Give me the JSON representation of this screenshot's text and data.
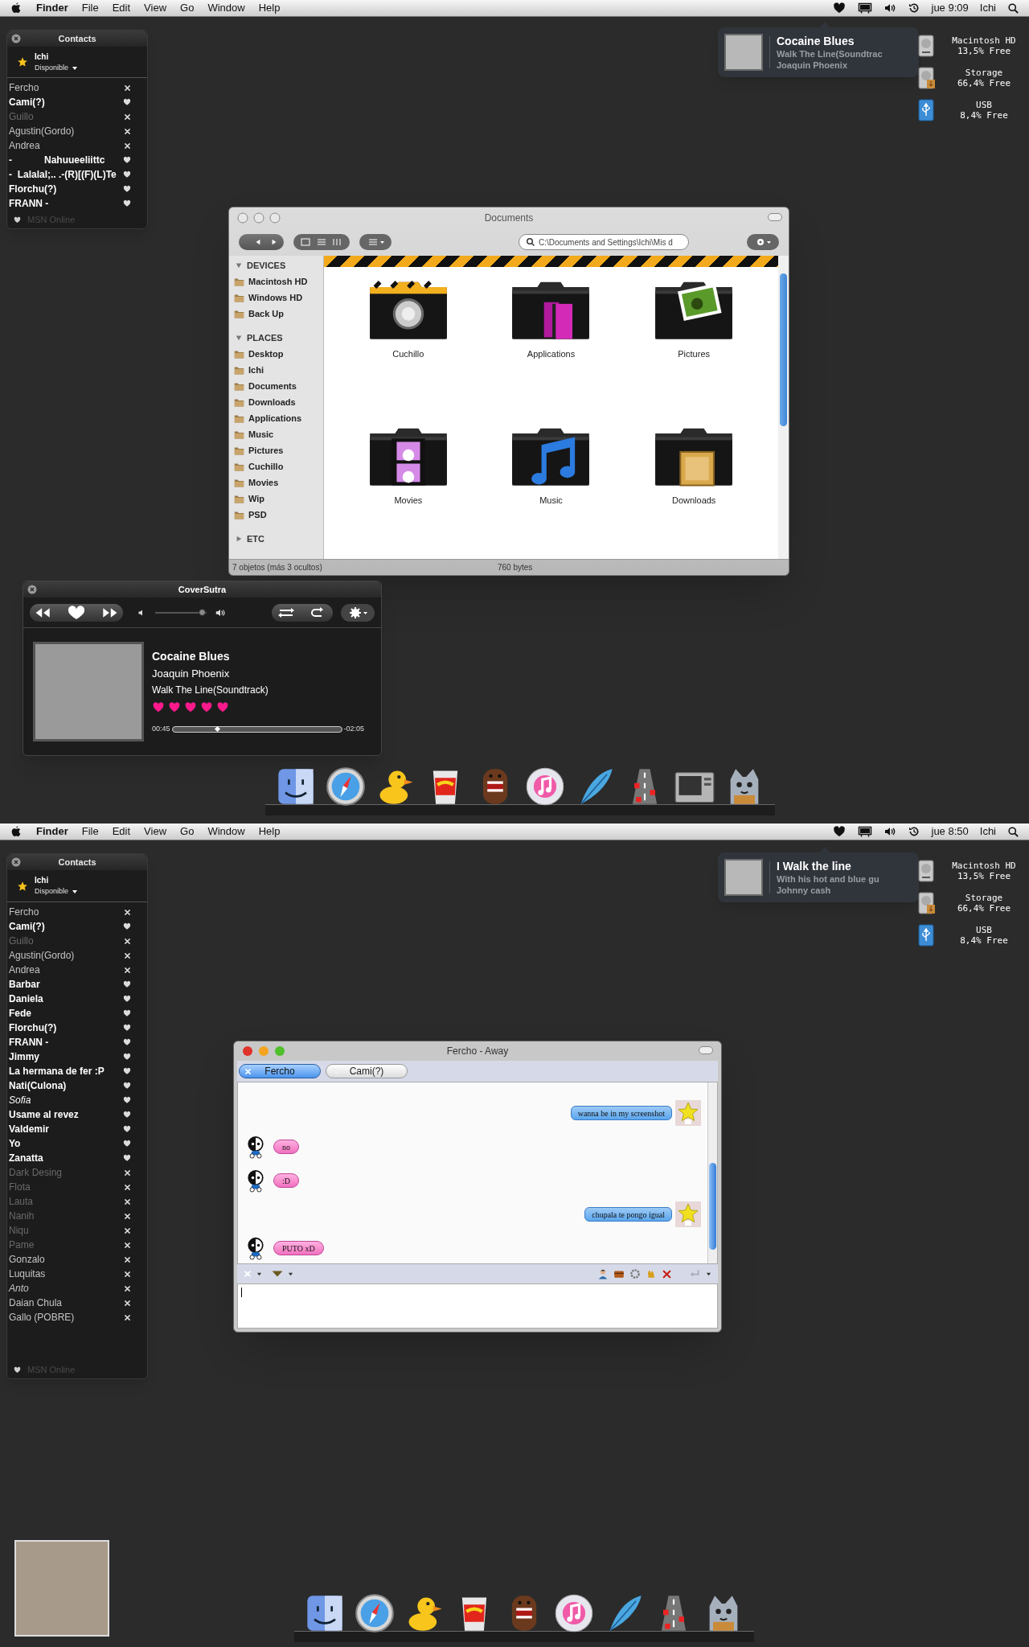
{
  "top_screen": {
    "menu_bar": {
      "app": "Finder",
      "menus": [
        "File",
        "Edit",
        "View",
        "Go",
        "Window",
        "Help"
      ],
      "clock": "jue 9:09",
      "user": "Ichi"
    },
    "contacts": {
      "title": "Contacts",
      "user": "Ichi",
      "status": "Disponible",
      "footer": "MSN Online",
      "contacts": [
        {
          "name": "Fercho",
          "online": false,
          "dimmed": false,
          "italic": false
        },
        {
          "name": "Cami(?)",
          "online": true,
          "dimmed": false,
          "italic": false
        },
        {
          "name": "Guillo",
          "online": false,
          "dimmed": true,
          "italic": false
        },
        {
          "name": "Agustin(Gordo)",
          "online": false,
          "dimmed": false,
          "italic": false
        },
        {
          "name": "Andrea",
          "online": false,
          "dimmed": false,
          "italic": false
        },
        {
          "name": "-            Nahuueeliittc",
          "online": true,
          "dimmed": false,
          "italic": false
        },
        {
          "name": "-  Lalalal;.. .-(R)[(F)(L)Te",
          "online": true,
          "dimmed": false,
          "italic": false
        },
        {
          "name": "Florchu(?)",
          "online": true,
          "dimmed": false,
          "italic": false
        },
        {
          "name": "FRANN -",
          "online": true,
          "dimmed": false,
          "italic": false
        }
      ]
    },
    "now_playing": {
      "title": "Cocaine Blues",
      "line_2": "Walk The Line(Soundtrac",
      "line_3": "Joaquin Phoenix"
    },
    "drives": [
      {
        "kind": "hd",
        "name": "Macintosh HD",
        "free": "13,5% Free"
      },
      {
        "kind": "storage",
        "name": "Storage",
        "free": "66,4% Free"
      },
      {
        "kind": "usb",
        "name": "USB",
        "free": "8,4% Free"
      }
    ],
    "finder": {
      "title": "Documents",
      "path": "C:\\Documents and Settings\\Ichi\\Mis d",
      "sidebar": [
        {
          "label": "DEVICES",
          "expanded": true,
          "items": [
            "Macintosh HD",
            "Windows HD",
            "Back Up"
          ]
        },
        {
          "label": "PLACES",
          "expanded": true,
          "items": [
            "Desktop",
            "Ichi",
            "Documents",
            "Downloads",
            "Applications",
            "Music",
            "Pictures",
            "Cuchillo",
            "Movies",
            "Wip",
            "PSD"
          ]
        },
        {
          "label": "ETC",
          "expanded": false
        }
      ],
      "items": [
        {
          "kind": "lock",
          "label": "Cuchillo"
        },
        {
          "kind": "books",
          "label": "Applications"
        },
        {
          "kind": "photo",
          "label": "Pictures"
        },
        {
          "kind": "film",
          "label": "Movies"
        },
        {
          "kind": "note",
          "label": "Music"
        },
        {
          "kind": "box",
          "label": "Downloads"
        }
      ],
      "status_left": "7 objetos (más 3 ocultos)",
      "status_right": "760 bytes"
    },
    "player": {
      "title": "CoverSutra",
      "volume": {
        "level": 0.92
      },
      "song": "Cocaine Blues",
      "artist": "Joaquin Phoenix",
      "album": "Walk The Line(Soundtrack)",
      "stars": 5,
      "elapsed": "00:45",
      "remaining": "-02:05",
      "progress": {
        "level": 0.27
      }
    }
  },
  "bottom_screen": {
    "menu_bar": {
      "app": "Finder",
      "menus": [
        "File",
        "Edit",
        "View",
        "Go",
        "Window",
        "Help"
      ],
      "clock": "jue 8:50",
      "user": "Ichi"
    },
    "contacts": {
      "title": "Contacts",
      "user": "Ichi",
      "status": "Disponible",
      "footer": "MSN Online",
      "contacts": [
        {
          "name": "Fercho",
          "online": false,
          "dimmed": false,
          "italic": false
        },
        {
          "name": "Cami(?)",
          "online": true,
          "dimmed": false,
          "italic": false
        },
        {
          "name": "Guillo",
          "online": false,
          "dimmed": true,
          "italic": false
        },
        {
          "name": "Agustin(Gordo)",
          "online": false,
          "dimmed": false,
          "italic": false
        },
        {
          "name": "Andrea",
          "online": false,
          "dimmed": false,
          "italic": false
        },
        {
          "name": "Barbar",
          "online": true,
          "dimmed": false,
          "italic": false
        },
        {
          "name": "Daniela",
          "online": true,
          "dimmed": false,
          "italic": false
        },
        {
          "name": "Fede",
          "online": true,
          "dimmed": false,
          "italic": false
        },
        {
          "name": "Florchu(?)",
          "online": true,
          "dimmed": false,
          "italic": false
        },
        {
          "name": "FRANN -",
          "online": true,
          "dimmed": false,
          "italic": false
        },
        {
          "name": "Jimmy",
          "online": true,
          "dimmed": false,
          "italic": false
        },
        {
          "name": "La hermana de fer :P",
          "online": true,
          "dimmed": false,
          "italic": false
        },
        {
          "name": "Nati(Culona)",
          "online": true,
          "dimmed": false,
          "italic": false
        },
        {
          "name": "Sofia",
          "online": true,
          "dimmed": false,
          "italic": true
        },
        {
          "name": "Usame al revez",
          "online": true,
          "dimmed": false,
          "italic": false
        },
        {
          "name": "Valdemir",
          "online": true,
          "dimmed": false,
          "italic": false
        },
        {
          "name": "Yo",
          "online": true,
          "dimmed": false,
          "italic": false
        },
        {
          "name": "Zanatta",
          "online": true,
          "dimmed": false,
          "italic": false
        },
        {
          "name": "Dark Desing",
          "online": false,
          "dimmed": true,
          "italic": false
        },
        {
          "name": "Flota",
          "online": false,
          "dimmed": true,
          "italic": false
        },
        {
          "name": "Lauta",
          "online": false,
          "dimmed": true,
          "italic": false
        },
        {
          "name": "Nanih",
          "online": false,
          "dimmed": true,
          "italic": false
        },
        {
          "name": "Niqu",
          "online": false,
          "dimmed": true,
          "italic": false
        },
        {
          "name": "Pame",
          "online": false,
          "dimmed": true,
          "italic": false
        },
        {
          "name": "Gonzalo",
          "online": false,
          "dimmed": false,
          "italic": false
        },
        {
          "name": "Luquitas",
          "online": false,
          "dimmed": false,
          "italic": false
        },
        {
          "name": "Anto",
          "online": false,
          "dimmed": false,
          "italic": true
        },
        {
          "name": "Daian Chula",
          "online": false,
          "dimmed": false,
          "italic": false
        },
        {
          "name": "Gallo (POBRE)",
          "online": false,
          "dimmed": false,
          "italic": false
        }
      ]
    },
    "now_playing": {
      "title": "I Walk the line",
      "line_2": "With his hot and blue gu",
      "line_3": "Johnny cash"
    },
    "drives": [
      {
        "kind": "hd",
        "name": "Macintosh HD",
        "free": "13,5% Free"
      },
      {
        "kind": "storage",
        "name": "Storage",
        "free": "66,4% Free"
      },
      {
        "kind": "usb",
        "name": "USB",
        "free": "8,4% Free"
      }
    ],
    "chat": {
      "title": "Fercho - Away",
      "tabs": [
        {
          "label": "Fercho",
          "selected": true
        },
        {
          "label": "Cami(?)",
          "selected": false
        }
      ],
      "messages": [
        {
          "kind": "sent",
          "text": "wanna be in my screenshot"
        },
        {
          "kind": "received",
          "text": "no"
        },
        {
          "kind": "received",
          "text": ":D"
        },
        {
          "kind": "sent",
          "text": "chupala te pongo igual"
        },
        {
          "kind": "received",
          "text": "PUTO xD"
        }
      ]
    }
  }
}
